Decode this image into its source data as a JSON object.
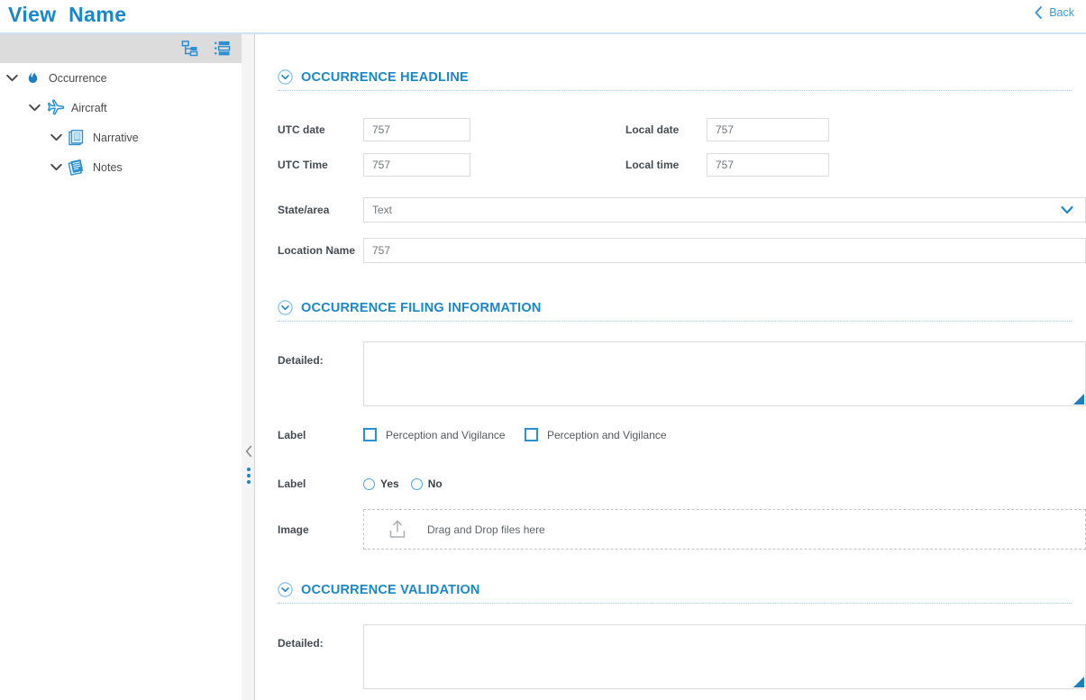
{
  "header": {
    "title": "View  Name",
    "back_label": "Back",
    "back_icon": "chevron-left-icon",
    "accent_color": "#1a87c8"
  },
  "sidebar": {
    "toolbar": [
      {
        "name": "hierarchy-view-icon",
        "label": "Hierarchy view"
      },
      {
        "name": "list-view-icon",
        "label": "List view"
      }
    ],
    "tree": [
      {
        "label": "Occurrence",
        "icon": "flame-icon",
        "level": 0,
        "expanded": true
      },
      {
        "label": "Aircraft",
        "icon": "airplane-icon",
        "level": 1,
        "expanded": true
      },
      {
        "label": "Narrative",
        "icon": "documents-icon",
        "level": 2,
        "expanded": true
      },
      {
        "label": "Notes",
        "icon": "notes-icon",
        "level": 2,
        "expanded": true
      }
    ],
    "collapse_icon": "chevron-left-icon",
    "drag_handle_icon": "vertical-dots-icon"
  },
  "sections": {
    "headline": {
      "title": "OCCURRENCE HEADLINE",
      "toggle_icon": "chevron-down-circle-icon",
      "fields": {
        "utc_date_label": "UTC date",
        "utc_date_value": "757",
        "local_date_label": "Local date",
        "local_date_value": "757",
        "utc_time_label": "UTC Time",
        "utc_time_value": "757",
        "local_time_label": "Local time",
        "local_time_value": "757",
        "state_area_label": "State/area",
        "state_area_value": "Text",
        "state_area_dropdown_icon": "chevron-down-icon",
        "location_name_label": "Location Name",
        "location_name_value": "757"
      }
    },
    "filing": {
      "title": "OCCURRENCE FILING INFORMATION",
      "toggle_icon": "chevron-down-circle-icon",
      "detailed_label": "Detailed:",
      "detailed_value": "",
      "checkbox_row_label": "Label",
      "checkboxes": [
        {
          "label": "Perception and Vigilance",
          "checked": false
        },
        {
          "label": "Perception and Vigilance",
          "checked": false
        }
      ],
      "radio_row_label": "Label",
      "radios": [
        {
          "label": "Yes",
          "selected": false
        },
        {
          "label": "No",
          "selected": false
        }
      ],
      "image_label": "Image",
      "dropzone_text": "Drag and Drop files here",
      "dropzone_icon": "upload-icon"
    },
    "validation": {
      "title": "OCCURRENCE VALIDATION",
      "toggle_icon": "chevron-down-circle-icon",
      "detailed_label": "Detailed:",
      "detailed_value": ""
    }
  }
}
